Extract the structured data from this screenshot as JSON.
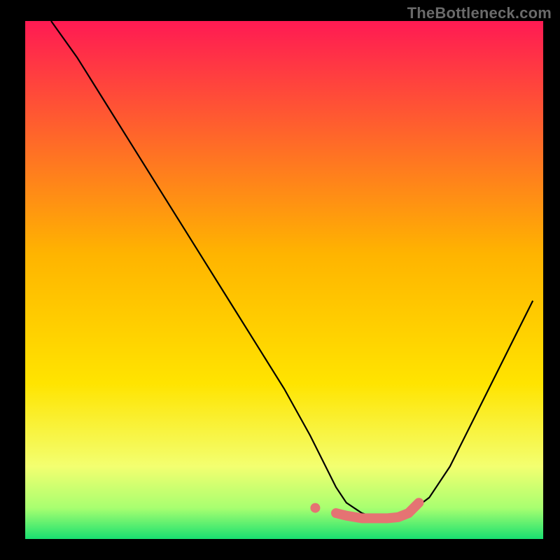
{
  "attribution": "TheBottleneck.com",
  "colors": {
    "gradient_top": "#ff1a53",
    "gradient_mid": "#ffd400",
    "gradient_low": "#edff6a",
    "gradient_bottom": "#18e070",
    "background": "#000000",
    "curve": "#000000",
    "dots": "#e57373"
  },
  "chart_data": {
    "type": "line",
    "title": "",
    "xlabel": "",
    "ylabel": "",
    "xlim": [
      0,
      100
    ],
    "ylim": [
      0,
      100
    ],
    "series": [
      {
        "name": "curve",
        "x": [
          5,
          10,
          15,
          20,
          25,
          30,
          35,
          40,
          45,
          50,
          55,
          58,
          60,
          62,
          65,
          68,
          70,
          72,
          74,
          78,
          82,
          86,
          90,
          94,
          98
        ],
        "y": [
          100,
          93,
          85,
          77,
          69,
          61,
          53,
          45,
          37,
          29,
          20,
          14,
          10,
          7,
          5,
          4,
          4,
          4,
          5,
          8,
          14,
          22,
          30,
          38,
          46
        ]
      }
    ],
    "highlight_dots": {
      "name": "bottom-markers",
      "x": [
        56,
        60,
        62,
        65,
        68,
        70,
        72,
        74,
        76
      ],
      "y": [
        6,
        5,
        4.5,
        4,
        4,
        4,
        4.2,
        5,
        7
      ]
    }
  }
}
